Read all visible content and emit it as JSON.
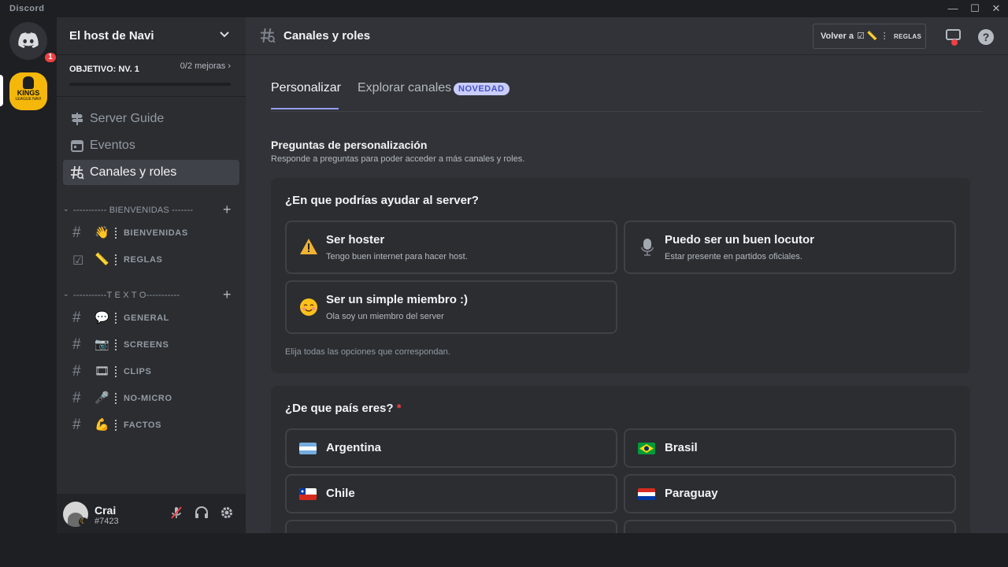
{
  "app": {
    "title": "Discord"
  },
  "guilds": {
    "home_badge": "1",
    "server_icon_text": "KINGS",
    "server_icon_sub": "LEAGUE NAVI"
  },
  "server": {
    "name": "El host de Navi",
    "goal_label": "OBJETIVO: NV. 1",
    "goal_progress": "0/2 mejoras",
    "goal_fraction": 0
  },
  "nav": [
    {
      "label": "Server Guide",
      "icon": "signpost-icon"
    },
    {
      "label": "Eventos",
      "icon": "calendar-icon"
    },
    {
      "label": "Canales y roles",
      "icon": "channels-roles-icon",
      "active": true
    }
  ],
  "categories": [
    {
      "title": "----------- BIENVENIDAS -------",
      "channels": [
        {
          "emoji": "👋",
          "name": "BIENVENIDAS"
        },
        {
          "emoji": "☑",
          "name": "REGLAS",
          "emoji2": "📏"
        }
      ]
    },
    {
      "title": "-----------T E X T O-----------",
      "channels": [
        {
          "emoji": "💬",
          "name": "GENERAL"
        },
        {
          "emoji": "📷",
          "name": "SCREENS"
        },
        {
          "emoji": "🎞",
          "name": "CLIPS"
        },
        {
          "emoji": "🎤",
          "name": "NO-MICRO"
        },
        {
          "emoji": "💪",
          "name": "FACTOS"
        }
      ]
    }
  ],
  "user": {
    "name": "Crai",
    "tag": "#7423"
  },
  "header": {
    "title": "Canales y roles",
    "volver_label": "Volver a",
    "volver_channel": "REGLAS"
  },
  "tabs": [
    {
      "label": "Personalizar",
      "active": true
    },
    {
      "label": "Explorar canales",
      "badge": "NOVEDAD"
    }
  ],
  "section": {
    "title": "Preguntas de personalización",
    "subtitle": "Responde a preguntas para poder acceder a más canales y roles."
  },
  "question1": {
    "title": "¿En que podrías ayudar al server?",
    "options": [
      {
        "emoji": "⚠️",
        "title": "Ser hoster",
        "subtitle": "Tengo buen internet para hacer host."
      },
      {
        "emoji": "🎙",
        "title": "Puedo ser un buen locutor",
        "subtitle": "Estar presente en partidos oficiales."
      },
      {
        "emoji": "☺️",
        "title": "Ser un simple miembro :)",
        "subtitle": "Ola soy un miembro del server"
      }
    ],
    "hint": "Elija todas las opciones que correspondan."
  },
  "question2": {
    "title": "¿De que país eres?",
    "required_mark": "*",
    "options": [
      {
        "label": "Argentina",
        "flag_colors": [
          "#74acdf",
          "#ffffff",
          "#74acdf"
        ]
      },
      {
        "label": "Brasil",
        "flag_colors": [
          "#009c3b",
          "#ffdf00",
          "#009c3b"
        ]
      },
      {
        "label": "Chile",
        "flag_colors": [
          "#ffffff",
          "#ffffff",
          "#d52b1e"
        ]
      },
      {
        "label": "Paraguay",
        "flag_colors": [
          "#d52b1e",
          "#ffffff",
          "#0038a8"
        ]
      }
    ]
  },
  "colors": {
    "accent": "#5865f2",
    "tab_underline": "#949cf7",
    "danger": "#f23f43"
  }
}
